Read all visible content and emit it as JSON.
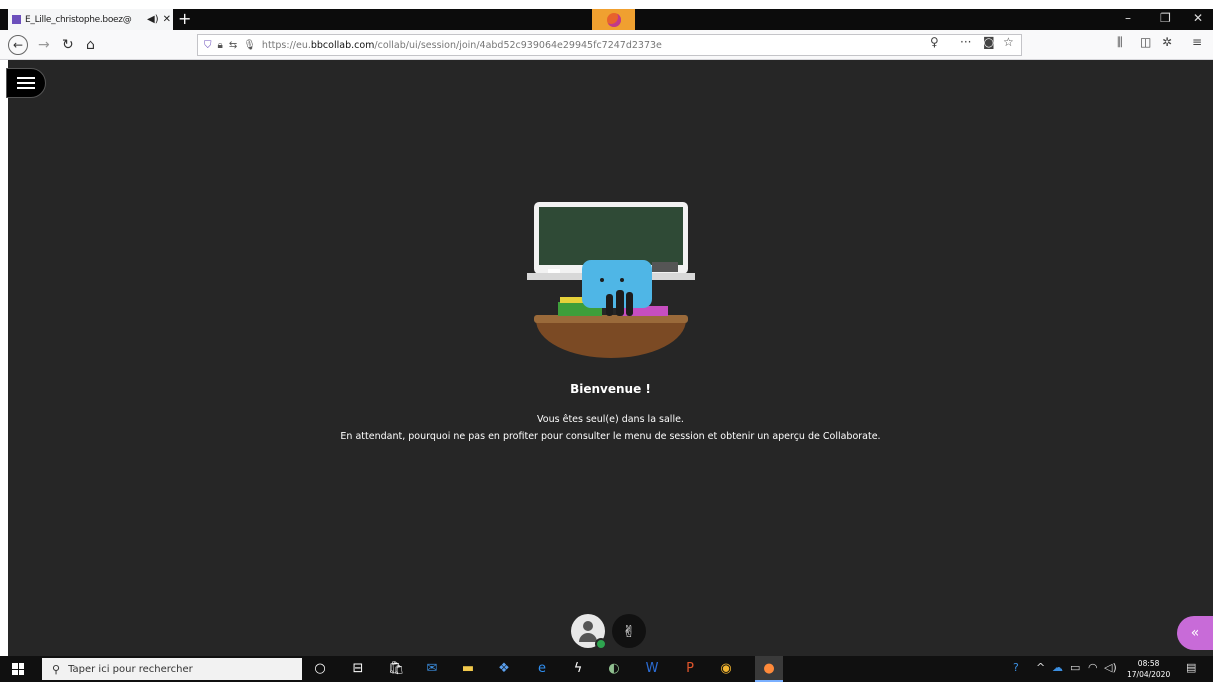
{
  "browser": {
    "tab_title": "E_Lille_christophe.boez@",
    "tab_audio_icon": "speaker-icon",
    "tab_close": "✕",
    "new_tab": "+",
    "window_controls": [
      "–",
      "❐",
      "✕"
    ]
  },
  "navbar": {
    "url_prefix": "https://eu.",
    "url_domain": "bbcollab.com",
    "url_path": "/collab/ui/session/join/4abd52c939064e29945fc7247d2373e",
    "page_actions": "···"
  },
  "session": {
    "welcome_title": "Bienvenue !",
    "line1": "Vous êtes seul(e) dans la salle.",
    "line2": "En attendant, pourquoi ne pas en profiter pour consulter le menu de session et obtenir un aperçu de Collaborate.",
    "collapse_glyph": "«",
    "hand_glyph": "✌"
  },
  "taskbar": {
    "search_placeholder": "Taper ici pour rechercher",
    "time": "08:58",
    "date": "17/04/2020"
  },
  "colors": {
    "session_bg": "#262626",
    "accent_purple": "#c86bd8",
    "status_green": "#2ea44f"
  }
}
